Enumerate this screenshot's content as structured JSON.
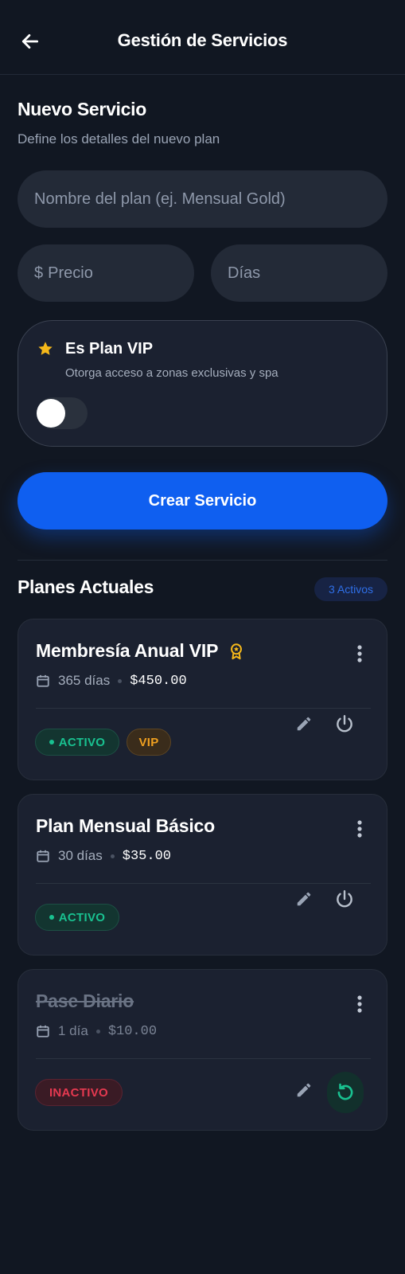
{
  "header": {
    "title": "Gestión de Servicios"
  },
  "form": {
    "title": "Nuevo Servicio",
    "subtitle": "Define los detalles del nuevo plan",
    "name_placeholder": "Nombre del plan (ej. Mensual Gold)",
    "price_prefix": "$",
    "price_placeholder": "Precio",
    "days_placeholder": "Días",
    "vip": {
      "title": "Es Plan VIP",
      "description": "Otorga acceso a zonas exclusivas y spa",
      "enabled": false
    },
    "create_button": "Crear Servicio"
  },
  "plans": {
    "title": "Planes Actuales",
    "count_label": "3 Activos",
    "items": [
      {
        "name": "Membresía Anual VIP",
        "days": "365 días",
        "price": "$450.00",
        "status": "ACTIVO",
        "vip_label": "VIP"
      },
      {
        "name": "Plan Mensual Básico",
        "days": "30 días",
        "price": "$35.00",
        "status": "ACTIVO"
      },
      {
        "name": "Pase Diario",
        "days": "1 día",
        "price": "$10.00",
        "status": "INACTIVO"
      }
    ]
  },
  "colors": {
    "background": "#111722",
    "card": "#1b2130",
    "primary": "#0f5ff0",
    "active": "#19c190",
    "vip": "#f0a020",
    "inactive": "#e63950",
    "star": "#f5b81a"
  },
  "icons": [
    "arrow-left-icon",
    "star-icon",
    "award-icon",
    "more-vertical-icon",
    "calendar-icon",
    "edit-icon",
    "power-icon",
    "restore-icon"
  ]
}
